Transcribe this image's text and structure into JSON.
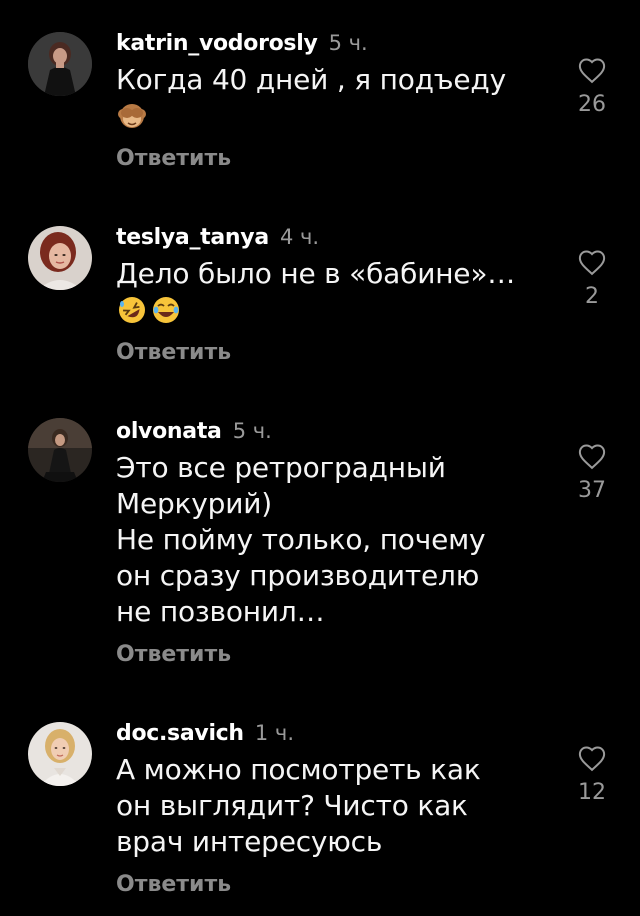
{
  "comments": [
    {
      "username": "katrin_vodorosly",
      "time": "5 ч.",
      "text": "Когда 40 дней , я подъеду",
      "emojis": [
        "see-no-evil-monkey"
      ],
      "reply_label": "Ответить",
      "likes": "26"
    },
    {
      "username": "teslya_tanya",
      "time": "4 ч.",
      "text": "Дело было не в «бабине»…",
      "emojis": [
        "rolling-on-floor-laughing",
        "tears-of-joy"
      ],
      "reply_label": "Ответить",
      "likes": "2"
    },
    {
      "username": "olvonata",
      "time": "5 ч.",
      "text": "Это все ретроградный\nМеркурий)\nНе пойму только, почему\nон сразу производителю\nне позвонил…",
      "emojis": [],
      "reply_label": "Ответить",
      "likes": "37"
    },
    {
      "username": "doc.savich",
      "time": "1 ч.",
      "text": "А можно посмотреть как\nон выглядит? Чисто как\nврач интересуюсь",
      "emojis": [],
      "reply_label": "Ответить",
      "likes": "12"
    }
  ],
  "colors": {
    "background": "#000000",
    "text": "#f5f5f5",
    "secondary": "#9a9a9a",
    "reply": "#8a8a8a"
  },
  "icons": {
    "like": "heart-outline-icon"
  }
}
